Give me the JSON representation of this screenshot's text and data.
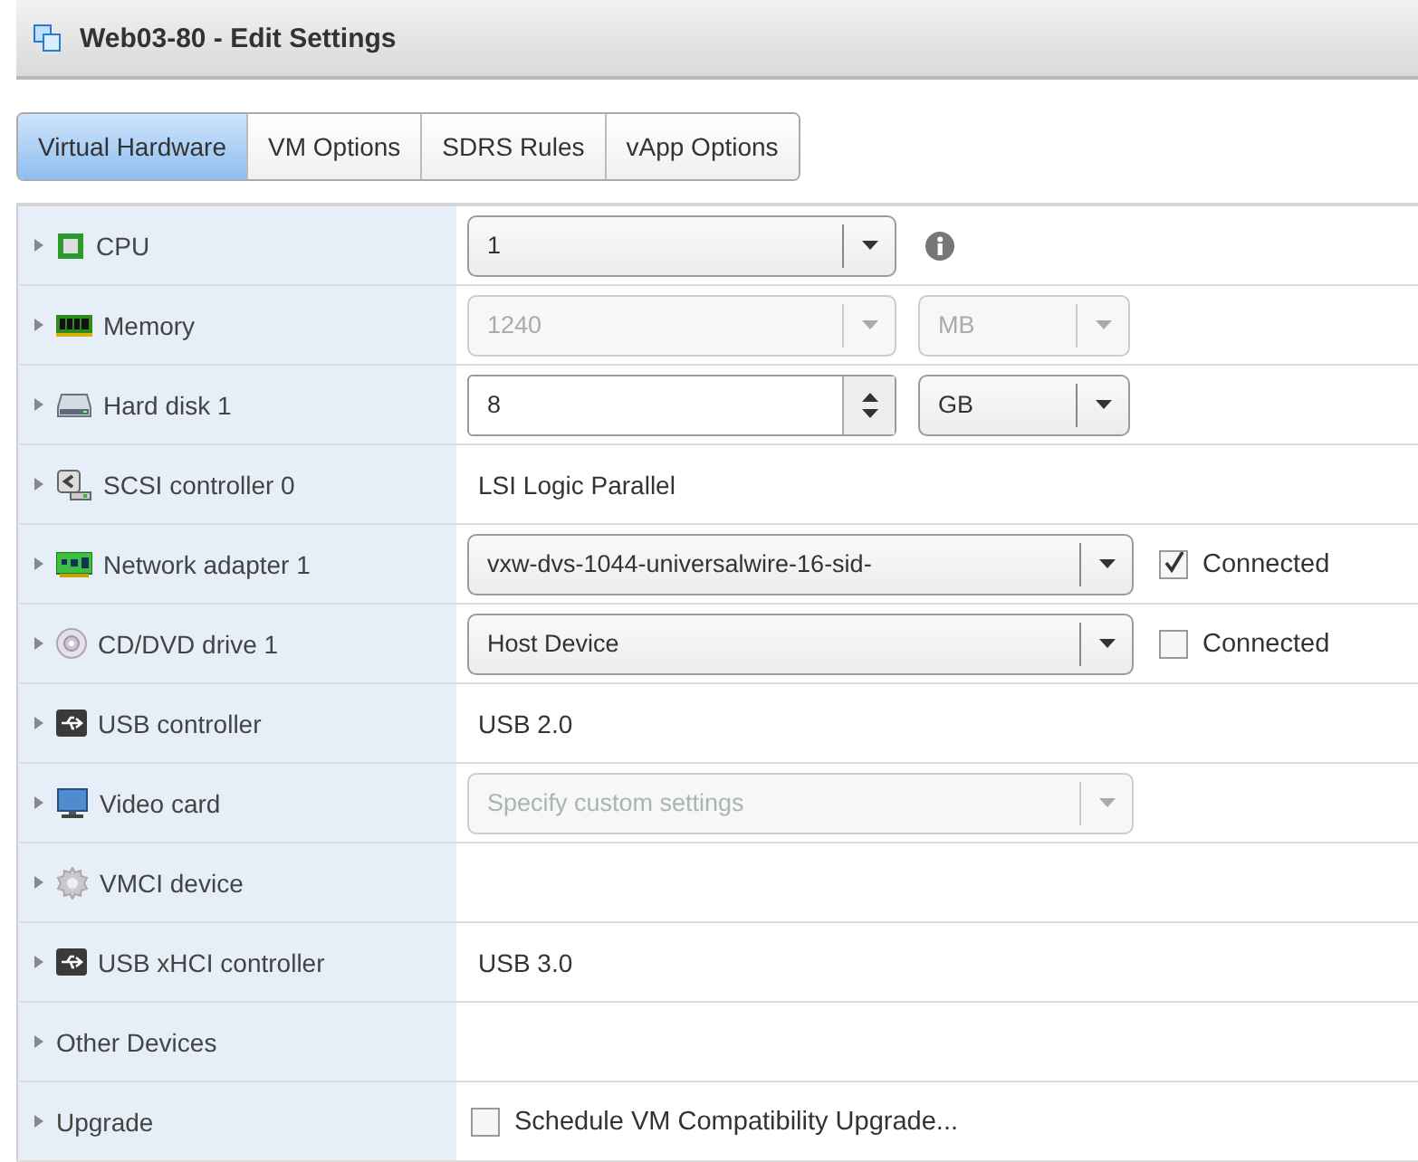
{
  "window": {
    "title": "Web03-80 - Edit Settings"
  },
  "tabs": [
    {
      "label": "Virtual Hardware",
      "selected": true
    },
    {
      "label": "VM Options",
      "selected": false
    },
    {
      "label": "SDRS Rules",
      "selected": false
    },
    {
      "label": "vApp Options",
      "selected": false
    }
  ],
  "rows": [
    {
      "label": "CPU",
      "expanded": false,
      "controls": [
        {
          "kind": "select",
          "value": "1",
          "disabled": false
        },
        {
          "kind": "info"
        }
      ]
    },
    {
      "label": "Memory",
      "expanded": false,
      "controls": [
        {
          "kind": "select",
          "value": "1240",
          "disabled": true
        },
        {
          "kind": "select",
          "value": "MB",
          "disabled": true
        }
      ]
    },
    {
      "label": "Hard disk 1",
      "expanded": false,
      "controls": [
        {
          "kind": "spinner",
          "value": "8"
        },
        {
          "kind": "select",
          "value": "GB",
          "disabled": false
        }
      ]
    },
    {
      "label": "SCSI controller 0",
      "expanded": false,
      "controls": [
        {
          "kind": "text",
          "text": "LSI Logic Parallel"
        }
      ]
    },
    {
      "label": "Network adapter 1",
      "expanded": false,
      "controls": [
        {
          "kind": "select",
          "value": "vxw-dvs-1044-universalwire-16-sid-",
          "disabled": false
        },
        {
          "kind": "checkbox",
          "label": "Connected",
          "checked": true
        }
      ]
    },
    {
      "label": "CD/DVD drive 1",
      "expanded": false,
      "controls": [
        {
          "kind": "select",
          "value": "Host Device",
          "disabled": false
        },
        {
          "kind": "checkbox",
          "label": "Connected",
          "checked": false
        }
      ]
    },
    {
      "label": "USB controller",
      "expanded": false,
      "controls": [
        {
          "kind": "text",
          "text": "USB 2.0"
        }
      ]
    },
    {
      "label": "Video card",
      "expanded": false,
      "controls": [
        {
          "kind": "select",
          "value": "Specify custom settings",
          "disabled": true
        }
      ]
    },
    {
      "label": "VMCI device",
      "expanded": false,
      "controls": []
    },
    {
      "label": "USB xHCI controller",
      "expanded": false,
      "controls": [
        {
          "kind": "text",
          "text": "USB 3.0"
        }
      ]
    },
    {
      "label": "Other Devices",
      "expanded": false,
      "controls": []
    },
    {
      "label": "Upgrade",
      "expanded": false,
      "controls": [
        {
          "kind": "checkbox",
          "label": "Schedule VM Compatibility Upgrade...",
          "checked": false
        }
      ]
    }
  ]
}
